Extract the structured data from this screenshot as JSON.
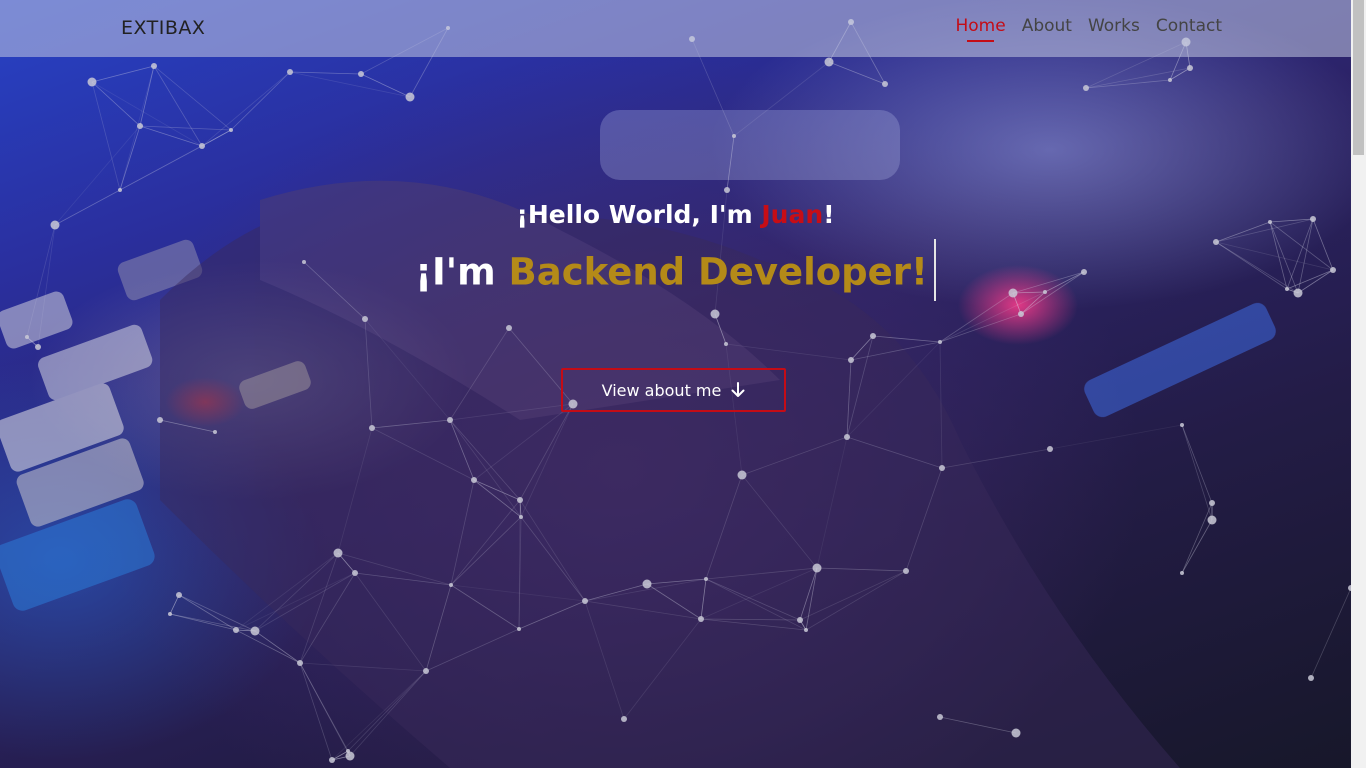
{
  "nav": {
    "brand": "EXTIBAX",
    "links": [
      {
        "label": "Home",
        "active": true
      },
      {
        "label": "About",
        "active": false
      },
      {
        "label": "Works",
        "active": false
      },
      {
        "label": "Contact",
        "active": false
      }
    ]
  },
  "hero": {
    "greeting_prefix": "¡Hello World, I'm ",
    "greeting_name": "Juan",
    "greeting_suffix": "!",
    "role_prefix": "¡I'm ",
    "role_title": "Backend Developer!",
    "cta_label": "View about me",
    "cta_icon": "arrow-down-icon"
  },
  "colors": {
    "accent_red": "#c40c16",
    "accent_gold": "#b48a18",
    "text_light": "#ffffff"
  }
}
